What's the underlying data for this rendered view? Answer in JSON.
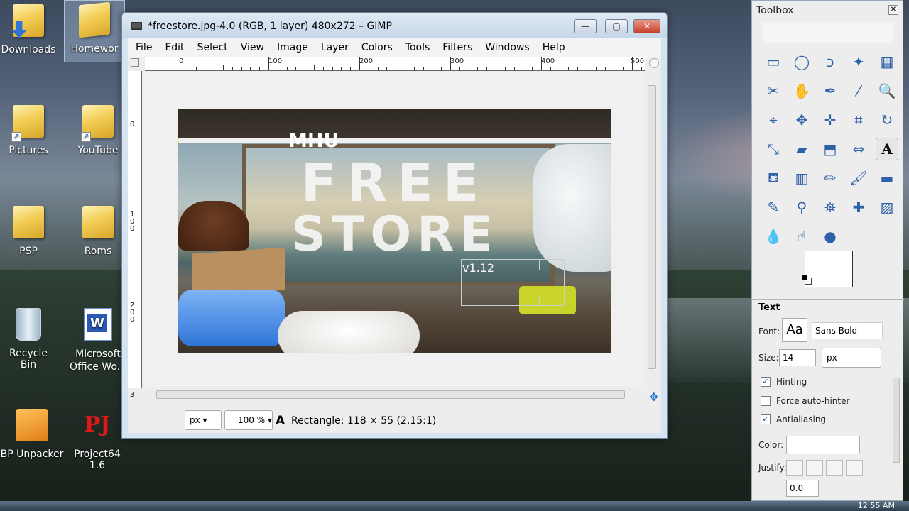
{
  "desktop": {
    "icons": [
      {
        "label": "Downloads"
      },
      {
        "label": "Homewor"
      },
      {
        "label": "Pictures"
      },
      {
        "label": "YouTube"
      },
      {
        "label": "PSP"
      },
      {
        "label": "Roms"
      },
      {
        "label": "Recycle Bin"
      },
      {
        "label": "Microsoft Office Wo..."
      },
      {
        "label": "BP Unpacker"
      },
      {
        "label": "Project64 1.6"
      }
    ],
    "clock": "12:55 AM"
  },
  "gimp": {
    "title": "*freestore.jpg-4.0 (RGB, 1 layer) 480x272 – GIMP",
    "menu": [
      "File",
      "Edit",
      "Select",
      "View",
      "Image",
      "Layer",
      "Colors",
      "Tools",
      "Filters",
      "Windows",
      "Help"
    ],
    "ruler_h_labels": [
      "0",
      "100",
      "200",
      "300",
      "400",
      "500"
    ],
    "ruler_v_labels": [
      "0",
      "1\n0\n0",
      "2\n0\n0",
      "3"
    ],
    "image_text": {
      "mhu": "MHU",
      "line1": "FREE",
      "line2": "STORE",
      "version": "v1.12"
    },
    "status": {
      "unit": "px",
      "zoom": "100 %",
      "message": "Rectangle: 118 × 55  (2.15:1)"
    }
  },
  "toolbox": {
    "title": "Toolbox",
    "tools": [
      "rect-select-icon",
      "ellipse-select-icon",
      "free-select-icon",
      "fuzzy-select-icon",
      "select-by-color-icon",
      "scissors-icon",
      "foreground-select-icon",
      "paths-icon",
      "color-picker-icon",
      "zoom-icon",
      "measure-icon",
      "move-icon",
      "align-icon",
      "crop-icon",
      "rotate-icon",
      "scale-icon",
      "shear-icon",
      "perspective-icon",
      "flip-icon",
      "text-icon",
      "bucket-fill-icon",
      "blend-icon",
      "pencil-icon",
      "paintbrush-icon",
      "eraser-icon",
      "airbrush-icon",
      "ink-icon",
      "clone-icon",
      "heal-icon",
      "perspective-clone-icon",
      "blur-icon",
      "smudge-icon",
      "dodge-burn-icon"
    ],
    "tool_glyphs": [
      "▭",
      "◯",
      "ↄ",
      "✦",
      "▦",
      "✂",
      "✋",
      "✒",
      "⁄",
      "🔍",
      "⌖",
      "✥",
      "✛",
      "⌗",
      "↻",
      "⤡",
      "▰",
      "⬒",
      "⇔",
      "A",
      "⛾",
      "▥",
      "✏",
      "🖌",
      "▬",
      "✎",
      "⚲",
      "⛯",
      "✚",
      "▨",
      "💧",
      "☝",
      "●"
    ],
    "options": {
      "title": "Text",
      "font_label": "Font:",
      "font_preview": "Aa",
      "font_name": "Sans Bold",
      "size_label": "Size:",
      "size_value": "14",
      "size_unit": "px",
      "hinting": "Hinting",
      "force_autohinter": "Force auto-hinter",
      "antialiasing": "Antialiasing",
      "color_label": "Color:",
      "justify_label": "Justify:",
      "indent_value": "0.0"
    }
  }
}
